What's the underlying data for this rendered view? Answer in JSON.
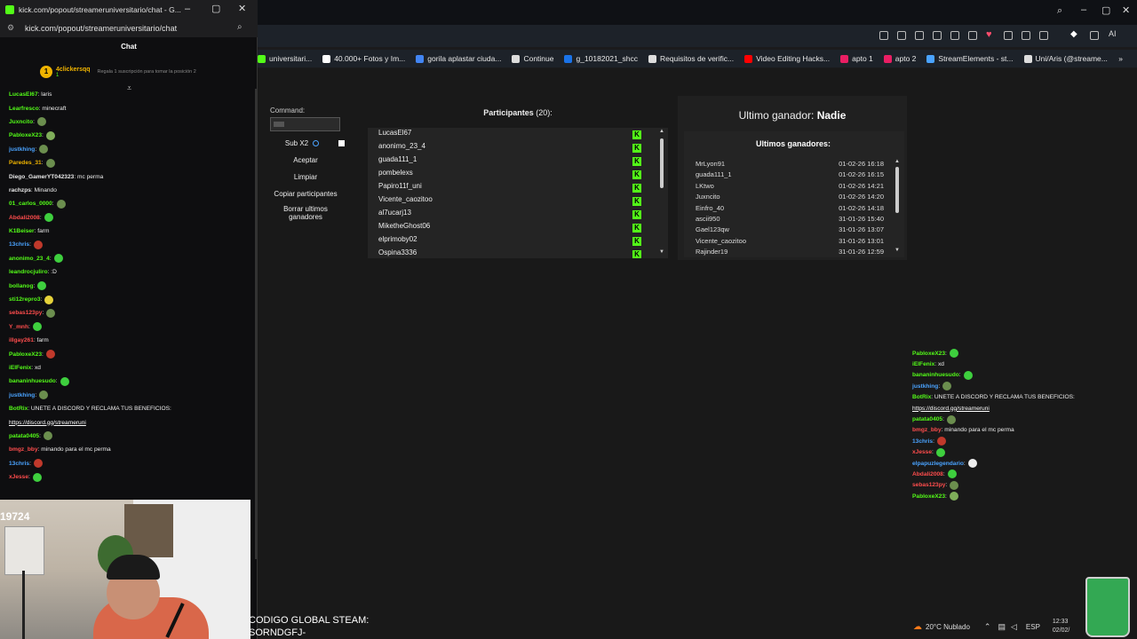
{
  "popup": {
    "title": "kick.com/popout/streameruniversitario/chat - G...",
    "url": "kick.com/popout/streameruniversitario/chat",
    "chat_header": "Chat",
    "gift": {
      "rank": "1",
      "name": "4clickersqq",
      "sub_badge": "1",
      "text": "Regala 1 suscripción para tomar la posición 2"
    },
    "messages": [
      {
        "user": "LucasEl67",
        "color": "#53fc18",
        "text": ": laris",
        "emote": null
      },
      {
        "user": "Learfresco",
        "color": "#53fc18",
        "text": ": minecraft",
        "emote": null
      },
      {
        "user": "Juxncito",
        "color": "#53fc18",
        "text": ":",
        "emote": "#6b8e4e"
      },
      {
        "user": "PabloxeX23",
        "color": "#53fc18",
        "text": ":",
        "emote": "#7fae5a"
      },
      {
        "user": "justkhing",
        "color": "#4aa3ff",
        "text": ":",
        "emote": "#6b8e4e"
      },
      {
        "user": "Paredes_31",
        "color": "#f0b400",
        "text": ":",
        "emote": "#6b8e4e"
      },
      {
        "user": "Diego_GamerYT042323",
        "color": "#e8e8e8",
        "text": ": mc perma",
        "emote": null
      },
      {
        "user": "rachzps",
        "color": "#e8e8e8",
        "text": ": Minando",
        "emote": null
      },
      {
        "user": "01_carlos_0000",
        "color": "#53fc18",
        "text": ":",
        "emote": "#6b8e4e"
      },
      {
        "user": "Abdali2008",
        "color": "#ff4d4d",
        "text": ":",
        "emote": "#3ecf3e"
      },
      {
        "user": "K1Beiser",
        "color": "#53fc18",
        "text": ": farm",
        "emote": null
      },
      {
        "user": "13chris",
        "color": "#4aa3ff",
        "text": ":",
        "emote": "#c0392b"
      },
      {
        "user": "anonimo_23_4",
        "color": "#53fc18",
        "text": ":",
        "emote": "#3ecf3e"
      },
      {
        "user": "leandrocjuliro",
        "color": "#53fc18",
        "text": ": :D",
        "emote": null
      },
      {
        "user": "bollanog",
        "color": "#53fc18",
        "text": ":",
        "emote": "#3ecf3e"
      },
      {
        "user": "sti12repro3",
        "color": "#53fc18",
        "text": ":",
        "emote": "#e6d23a"
      },
      {
        "user": "sebas123py",
        "color": "#ff4d4d",
        "text": ":",
        "emote": "#6b8e4e"
      },
      {
        "user": "Y_mnh",
        "color": "#ff4d4d",
        "text": ":",
        "emote": "#3ecf3e"
      },
      {
        "user": "illgay261",
        "color": "#ff4d4d",
        "text": ": farm",
        "emote": null
      },
      {
        "user": "PabloxeX23",
        "color": "#53fc18",
        "text": ":",
        "emote": "#c0392b"
      },
      {
        "user": "iElFenix",
        "color": "#53fc18",
        "text": ": xd",
        "emote": null
      },
      {
        "user": "bananinhuesudo",
        "color": "#53fc18",
        "text": ":",
        "emote": "#3ecf3e"
      },
      {
        "user": "justkhing",
        "color": "#4aa3ff",
        "text": ":",
        "emote": "#6b8e4e"
      },
      {
        "user": "BotRix",
        "color": "#53fc18",
        "text": ": UNETE A DISCORD Y RECLAMA TUS BENEFICIOS:",
        "emote": null
      },
      {
        "user": "",
        "color": "#fff",
        "text": "https://discord.gg/streameruni",
        "emote": null
      },
      {
        "user": "patata0405",
        "color": "#53fc18",
        "text": ":",
        "emote": "#6b8e4e"
      },
      {
        "user": "bmgz_bby",
        "color": "#ff4d4d",
        "text": ": minando para el mc perma",
        "emote": null
      },
      {
        "user": "13chris",
        "color": "#4aa3ff",
        "text": ":",
        "emote": "#c0392b"
      },
      {
        "user": "xJesse",
        "color": "#ff4d4d",
        "text": ":",
        "emote": "#3ecf3e"
      }
    ],
    "cam_number": "19724"
  },
  "bookmarks": [
    {
      "label": "universitari...",
      "color": "#53fc18"
    },
    {
      "label": "40.000+ Fotos y Im...",
      "color": "#ffffff"
    },
    {
      "label": "gorila aplastar ciuda...",
      "color": "#4285f4"
    },
    {
      "label": "Continue",
      "color": "#dddddd"
    },
    {
      "label": "g_10182021_shcc",
      "color": "#1a73e8"
    },
    {
      "label": "Requisitos de verific...",
      "color": "#dddddd"
    },
    {
      "label": "Video Editing Hacks...",
      "color": "#ff0000"
    },
    {
      "label": "apto 1",
      "color": "#e91e63"
    },
    {
      "label": "apto 2",
      "color": "#e91e63"
    },
    {
      "label": "StreamElements - st...",
      "color": "#4aa3ff"
    },
    {
      "label": "Uni/Aris (@streame...",
      "color": "#dddddd"
    }
  ],
  "controls": {
    "command_label": "Command:",
    "sub_label": "Sub X2",
    "accept": "Aceptar",
    "clear": "Limpiar",
    "copy": "Copiar participantes",
    "delete_winners": "Borrar ultimos ganadores"
  },
  "participants": {
    "title": "Participantes",
    "count": "(20):",
    "badge": "K",
    "list": [
      "LucasEl67",
      "anonimo_23_4",
      "guada111_1",
      "pombelexs",
      "Papiro11f_uni",
      "Vicente_caozitoo",
      "al7ucarj13",
      "MiketheGhost06",
      "elprimoby02",
      "Ospina3336"
    ]
  },
  "winners": {
    "last_label": "Ultimo ganador:",
    "last_value": "Nadie",
    "title": "Ultimos ganadores:",
    "list": [
      {
        "name": "MrLyon91",
        "date": "01-02-26 16:18"
      },
      {
        "name": "guada111_1",
        "date": "01-02-26 16:15"
      },
      {
        "name": "LKtwo",
        "date": "01-02-26 14:21"
      },
      {
        "name": "Juxncito",
        "date": "01-02-26 14:20"
      },
      {
        "name": "Einfro_40",
        "date": "01-02-26 14:18"
      },
      {
        "name": "ascii950",
        "date": "31-01-26 15:40"
      },
      {
        "name": "Gael123qw",
        "date": "31-01-26 13:07"
      },
      {
        "name": "Vicente_caozitoo",
        "date": "31-01-26 13:01"
      },
      {
        "name": "Rajinder19",
        "date": "31-01-26 12:59"
      }
    ]
  },
  "overlay_chat": [
    {
      "user": "PabloxeX23",
      "color": "#53fc18",
      "text": ":",
      "emote": "#3ecf3e"
    },
    {
      "user": "iElFenix",
      "color": "#53fc18",
      "text": ": xd",
      "emote": null
    },
    {
      "user": "bananinhuesudo",
      "color": "#53fc18",
      "text": ":",
      "emote": "#3ecf3e"
    },
    {
      "user": "justkhing",
      "color": "#4aa3ff",
      "text": ":",
      "emote": "#6b8e4e"
    },
    {
      "user": "BotRix",
      "color": "#53fc18",
      "text": ": UNETE A DISCORD Y RECLAMA TUS BENEFICIOS:",
      "emote": null
    },
    {
      "user": "",
      "color": "#fff",
      "text": "https://discord.gg/streameruni",
      "emote": null
    },
    {
      "user": "patata0405",
      "color": "#53fc18",
      "text": ":",
      "emote": "#6b8e4e"
    },
    {
      "user": "bmgz_bby",
      "color": "#ff4d4d",
      "text": ": minando para el mc perma",
      "emote": null
    },
    {
      "user": "13chris",
      "color": "#4aa3ff",
      "text": ":",
      "emote": "#c0392b"
    },
    {
      "user": "xJesse",
      "color": "#ff4d4d",
      "text": ":",
      "emote": "#3ecf3e"
    },
    {
      "user": "elpapuzlegendario",
      "color": "#4aa3ff",
      "text": ":",
      "emote": "#eeeeee"
    },
    {
      "user": "Abdali2008",
      "color": "#ff4d4d",
      "text": ":",
      "emote": "#3ecf3e"
    },
    {
      "user": "sebas123py",
      "color": "#ff4d4d",
      "text": ":",
      "emote": "#6b8e4e"
    },
    {
      "user": "PabloxeX23",
      "color": "#53fc18",
      "text": ":",
      "emote": "#7fae5a"
    }
  ],
  "bottom": {
    "code_line1": "CODIGO GLOBAL STEAM:",
    "code_line2": "SORNDGFJ-",
    "weather": "20°C Nublado",
    "lang": "ESP",
    "time": "12:33",
    "date": "02/02/"
  }
}
